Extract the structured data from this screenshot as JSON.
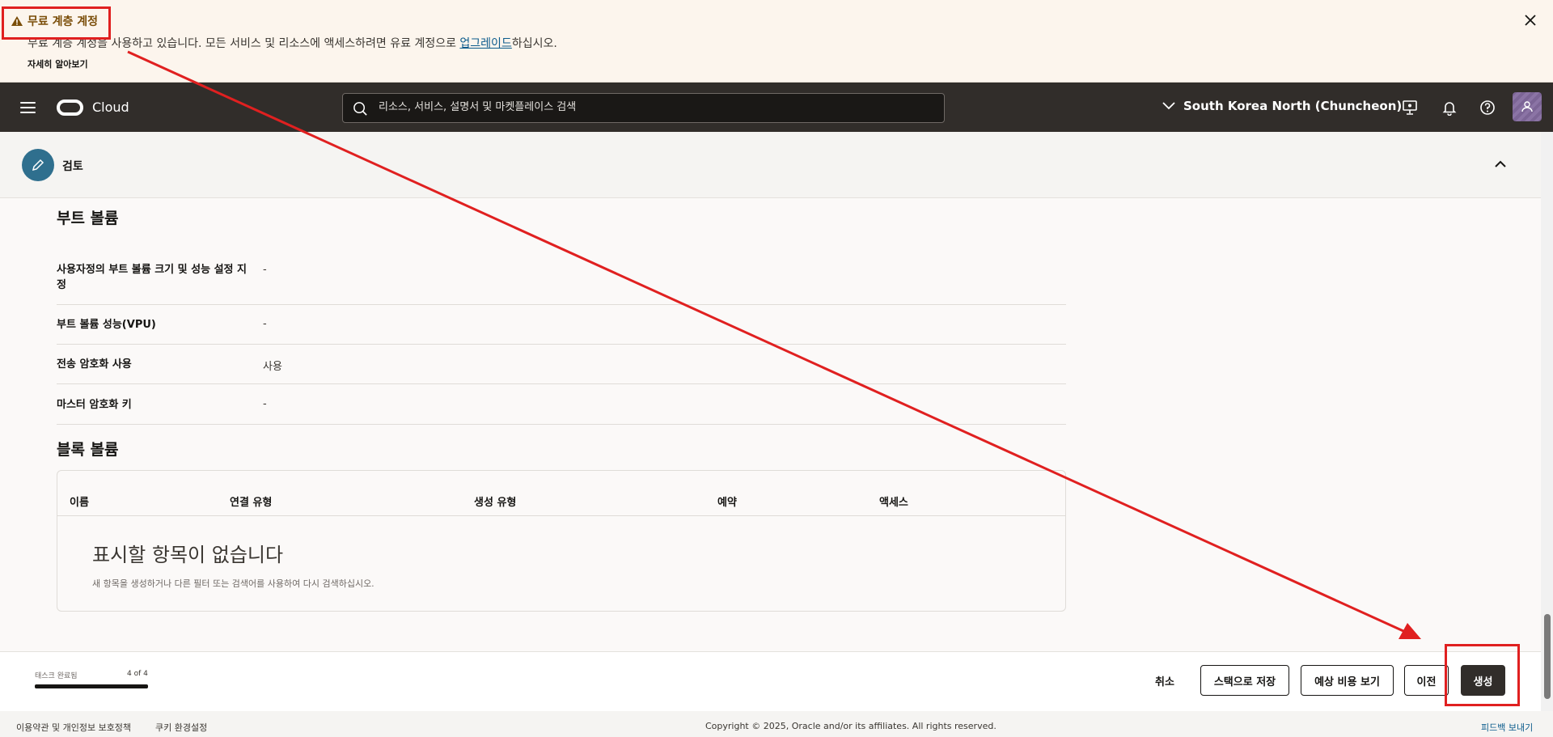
{
  "banner": {
    "title": "무료 계층 계정",
    "message_before": "무료 계층 계정을 사용하고 있습니다. 모든 서비스 및 리소스에 액세스하려면 유료 계정으로 ",
    "message_link": "업그레이드",
    "message_after": "하십시오.",
    "learn_more": "자세히 알아보기"
  },
  "header": {
    "brand": "Cloud",
    "search_placeholder": "리소스, 서비스, 설명서 및 마켓플레이스 검색",
    "region": "South Korea North (Chuncheon)"
  },
  "review": {
    "label": "검토"
  },
  "boot_volume": {
    "heading": "부트 볼륨",
    "rows": [
      {
        "key": "사용자정의 부트 볼륨 크기 및 성능 설정 지정",
        "value": "-"
      },
      {
        "key": "부트 볼륨 성능(VPU)",
        "value": "-"
      },
      {
        "key": "전송 암호화 사용",
        "value": "사용"
      },
      {
        "key": "마스터 암호화 키",
        "value": "-"
      }
    ]
  },
  "block_volume": {
    "heading": "블록 볼륨",
    "columns": [
      "이름",
      "연결 유형",
      "생성 유형",
      "예약",
      "액세스"
    ],
    "empty_title": "표시할 항목이 없습니다",
    "empty_subtitle": "새 항목을 생성하거나 다른 필터 또는 검색어를 사용하여 다시 검색하십시오."
  },
  "actions": {
    "task_label": "태스크 완료됨",
    "task_count": "4 of 4",
    "progress_fraction": 1.0,
    "cancel": "취소",
    "save_stack": "스택으로 저장",
    "estimate": "예상 비용 보기",
    "previous": "이전",
    "create": "생성"
  },
  "footer": {
    "terms": "이용약관 및 개인정보 보호정책",
    "cookies": "쿠키 환경설정",
    "copyright": "Copyright © 2025, Oracle and/or its affiliates. All rights reserved.",
    "feedback": "피드백 보내기"
  },
  "colors": {
    "header_bg": "#312d2a",
    "banner_bg": "#fcf5ed",
    "annotation": "#e02020",
    "primary_button": "#312d2a"
  }
}
